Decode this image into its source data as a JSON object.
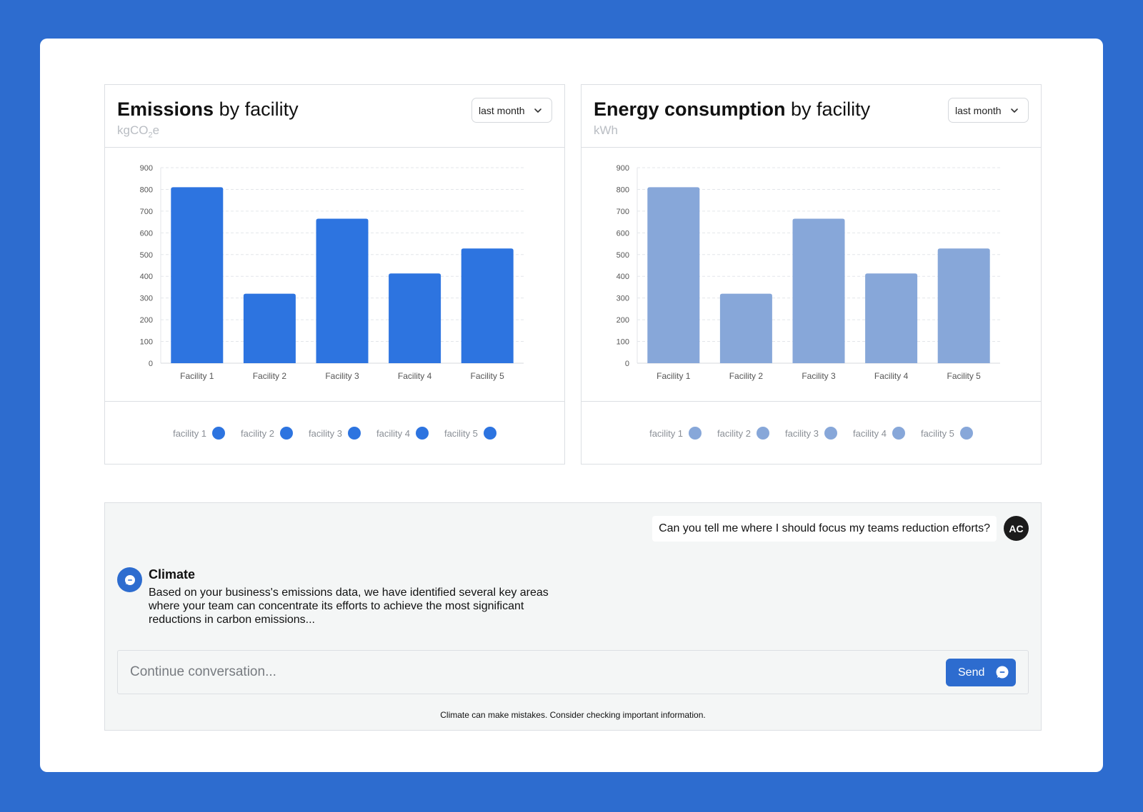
{
  "charts": {
    "emissions": {
      "title_bold": "Emissions",
      "title_rest": " by facility",
      "unit_main": "kgCO",
      "unit_sub": "2",
      "unit_tail": "e",
      "period": "last month",
      "color": "#2d74e0"
    },
    "energy": {
      "title_bold": "Energy consumption",
      "title_rest": " by facility",
      "unit": "kWh",
      "period": "last month",
      "color": "#87a7d9"
    }
  },
  "chart_data": [
    {
      "type": "bar",
      "categories": [
        "Facility 1",
        "Facility 2",
        "Facility 3",
        "Facility 4",
        "Facility 5"
      ],
      "values": [
        810,
        320,
        665,
        413,
        528
      ],
      "ylim": [
        0,
        900
      ],
      "yticks": [
        0,
        100,
        200,
        300,
        400,
        500,
        600,
        700,
        800,
        900
      ],
      "grid": true,
      "legend": [
        "facility 1",
        "facility 2",
        "facility 3",
        "facility 4",
        "facility 5"
      ],
      "legend_placement": "bottom"
    },
    {
      "type": "bar",
      "categories": [
        "Facility 1",
        "Facility 2",
        "Facility 3",
        "Facility 4",
        "Facility 5"
      ],
      "values": [
        810,
        320,
        665,
        413,
        528
      ],
      "ylim": [
        0,
        900
      ],
      "yticks": [
        0,
        100,
        200,
        300,
        400,
        500,
        600,
        700,
        800,
        900
      ],
      "grid": true,
      "legend": [
        "facility 1",
        "facility 2",
        "facility 3",
        "facility 4",
        "facility 5"
      ],
      "legend_placement": "bottom"
    }
  ],
  "chat": {
    "user_message": "Can you tell me where I should focus my teams reduction efforts?",
    "user_initials": "AC",
    "bot_name": "Climate",
    "bot_message": "Based on your business's emissions data, we have identified several key areas where your team can concentrate its efforts to achieve the most significant reductions in carbon emissions...",
    "input_placeholder": "Continue conversation...",
    "send_label": "Send",
    "disclaimer": "Climate can make mistakes. Consider checking important information."
  }
}
